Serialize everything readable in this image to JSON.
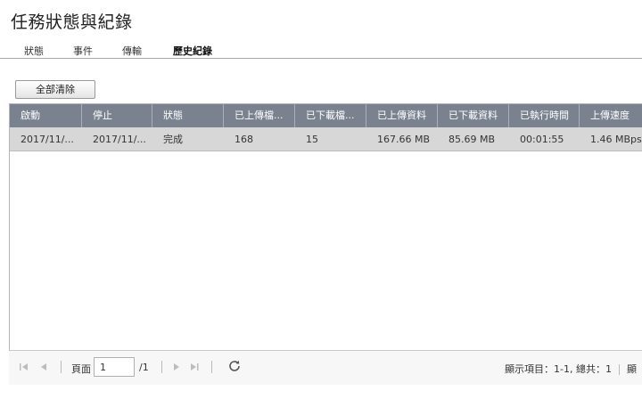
{
  "title": "任務狀態與紀錄",
  "tabs": [
    {
      "label": "狀態"
    },
    {
      "label": "事件"
    },
    {
      "label": "傳輸"
    },
    {
      "label": "歷史紀錄"
    }
  ],
  "clear_all_label": "全部清除",
  "columns": [
    "啟動",
    "停止",
    "狀態",
    "已上傳檔...",
    "已下載檔...",
    "已上傳資料",
    "已下載資料",
    "已執行時間",
    "上傳速度"
  ],
  "rows": [
    [
      "2017/11/...",
      "2017/11/...",
      "完成",
      "168",
      "15",
      "167.66 MB",
      "85.69 MB",
      "00:01:55",
      "1.46 MBps"
    ]
  ],
  "pager": {
    "page_label": "頁面",
    "page_value": "1",
    "page_total": "/1",
    "display_info": "顯示項目：1-1, 總共：1",
    "display_extra": "顯"
  },
  "colors": {
    "header_bg": "#7a8290",
    "row_selected_bg": "#d7d7d7"
  }
}
